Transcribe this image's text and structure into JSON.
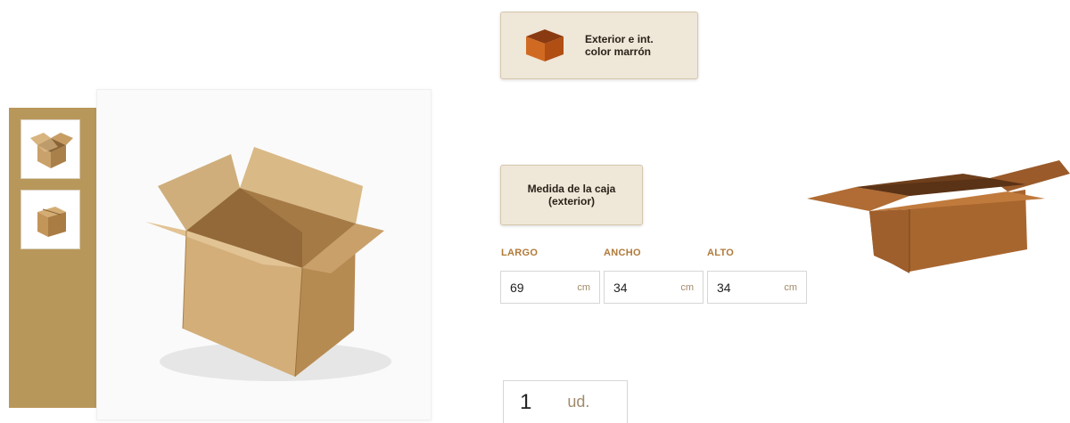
{
  "gallery": {
    "thumbnails": [
      {
        "icon": "open-box-icon"
      },
      {
        "icon": "closed-box-icon"
      }
    ],
    "main_image_icon": "open-cardboard-box-image"
  },
  "color_option": {
    "label": "Exterior e int.\ncolor marrón",
    "swatch_color": "#b85a1c"
  },
  "size_option": {
    "label": "Medida de la caja\n(exterior)"
  },
  "dimensions": [
    {
      "label": "LARGO",
      "value": "69",
      "unit": "cm"
    },
    {
      "label": "ANCHO",
      "value": "34",
      "unit": "cm"
    },
    {
      "label": "ALTO",
      "value": "34",
      "unit": "cm"
    }
  ],
  "quantity": {
    "value": "1",
    "unit": "ud."
  },
  "colors": {
    "rail": "#b8975a",
    "button_bg": "#efe7d8",
    "dim_label": "#b07a3a",
    "box_brown": "#a8662f"
  }
}
